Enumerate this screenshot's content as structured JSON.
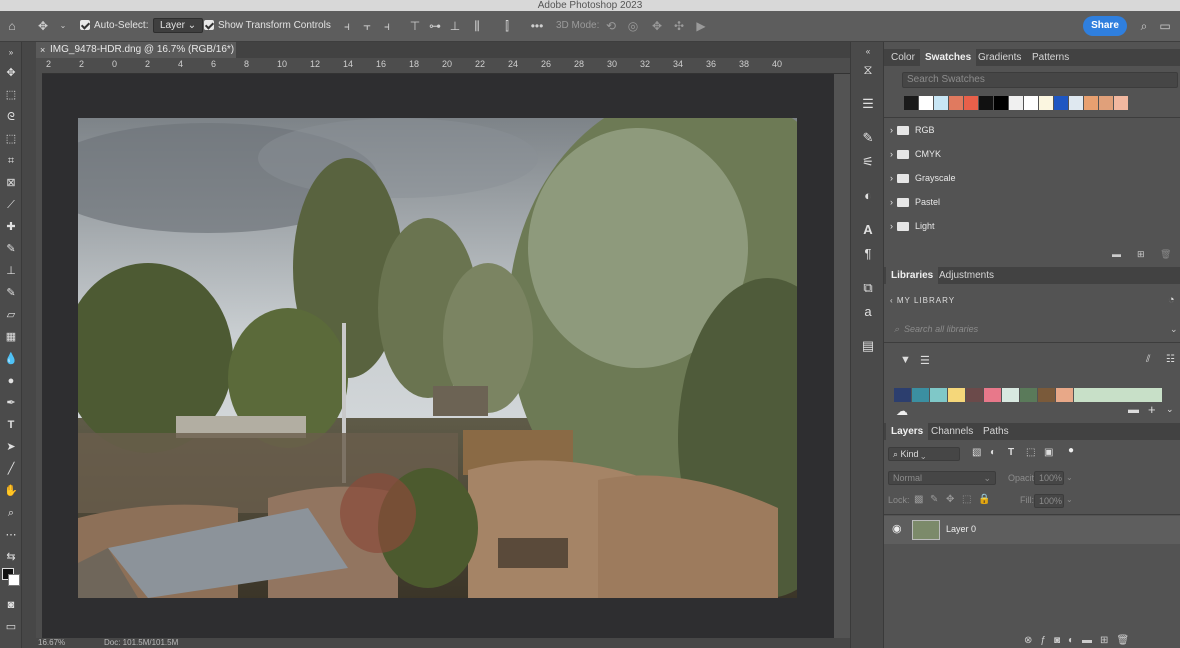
{
  "app": {
    "title": "Adobe Photoshop 2023"
  },
  "options_bar": {
    "auto_select_label": "Auto-Select:",
    "layer_dropdown": "Layer",
    "show_transform_label": "Show Transform Controls",
    "mode_3d_label": "3D Mode:",
    "share_label": "Share"
  },
  "document": {
    "tab_title": "IMG_9478-HDR.dng @ 16.7% (RGB/16*)",
    "ruler_ticks": [
      "2",
      "2",
      "0",
      "2",
      "4",
      "6",
      "8",
      "10",
      "12",
      "14",
      "16",
      "18",
      "20",
      "22",
      "24",
      "26",
      "28",
      "30",
      "32",
      "34",
      "36",
      "38",
      "40"
    ],
    "status_zoom": "16.67%",
    "status_doc": "Doc: 101.5M/101.5M"
  },
  "swatches_panel": {
    "tabs": [
      "Color",
      "Swatches",
      "Gradients",
      "Patterns"
    ],
    "active_tab": "Swatches",
    "search_placeholder": "Search Swatches",
    "recent_colors": [
      "#1a1a1a",
      "#ffffff",
      "#c8e6f5",
      "#e07a5f",
      "#e8604a",
      "#111111",
      "#000000",
      "#f0f0f0",
      "#ffffff",
      "#fbf6e0",
      "#1e56c2",
      "#dfe8f0",
      "#e8a070",
      "#e0a07a",
      "#f2b8a0"
    ],
    "groups": [
      "RGB",
      "CMYK",
      "Grayscale",
      "Pastel",
      "Light"
    ]
  },
  "libraries_panel": {
    "tabs": [
      "Libraries",
      "Adjustments"
    ],
    "active_tab": "Libraries",
    "library_name": "MY LIBRARY",
    "search_placeholder": "Search all libraries",
    "colors": [
      "#2c3e6e",
      "#3b8fa1",
      "#7fc8c8",
      "#f5d77a",
      "#6b4a4a",
      "#e8788a",
      "#d8e8e0",
      "#5a7a5a",
      "#7a5a3a",
      "#e8a888",
      "#c8e0c8"
    ]
  },
  "layers_panel": {
    "tabs": [
      "Layers",
      "Channels",
      "Paths"
    ],
    "active_tab": "Layers",
    "filter_kind": "Kind",
    "blend_mode": "Normal",
    "opacity_label": "Opacity:",
    "opacity_value": "100%",
    "lock_label": "Lock:",
    "fill_label": "Fill:",
    "fill_value": "100%",
    "layers": [
      {
        "name": "Layer 0",
        "visible": true
      }
    ]
  }
}
